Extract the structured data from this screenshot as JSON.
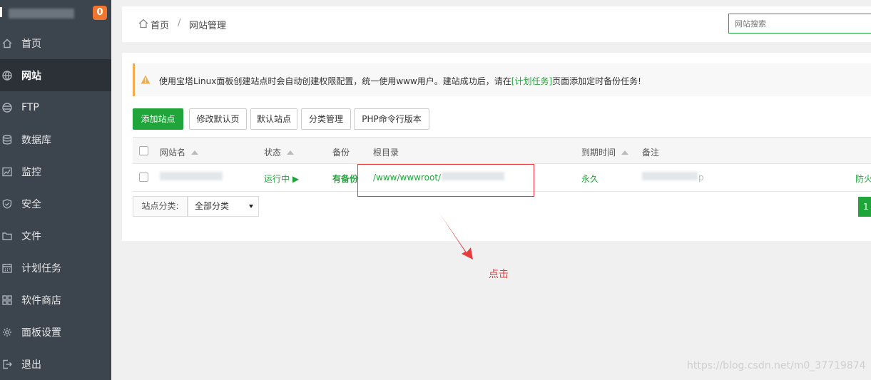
{
  "sidebar": {
    "badge": "0",
    "items": [
      {
        "label": "首页",
        "icon": "home-icon"
      },
      {
        "label": "网站",
        "icon": "globe-icon"
      },
      {
        "label": "FTP",
        "icon": "ftp-icon"
      },
      {
        "label": "数据库",
        "icon": "database-icon"
      },
      {
        "label": "监控",
        "icon": "monitor-icon"
      },
      {
        "label": "安全",
        "icon": "shield-icon"
      },
      {
        "label": "文件",
        "icon": "folder-icon"
      },
      {
        "label": "计划任务",
        "icon": "calendar-icon"
      },
      {
        "label": "软件商店",
        "icon": "grid-icon"
      },
      {
        "label": "面板设置",
        "icon": "gear-icon"
      },
      {
        "label": "退出",
        "icon": "logout-icon"
      }
    ],
    "active_index": 1
  },
  "header": {
    "breadcrumb_home": "首页",
    "breadcrumb_sep": "/",
    "breadcrumb_current": "网站管理",
    "search_placeholder": "网站搜索"
  },
  "notice": {
    "text_before": "使用宝塔Linux面板创建站点时会自动创建权限配置，统一使用www用户。建站成功后，请在",
    "link": "[计划任务]",
    "text_after": "页面添加定时备份任务!"
  },
  "toolbar": {
    "add_site": "添加站点",
    "edit_default_page": "修改默认页",
    "default_site": "默认站点",
    "category_manage": "分类管理",
    "php_cli_version": "PHP命令行版本"
  },
  "table": {
    "headers": {
      "name": "网站名",
      "status": "状态",
      "backup": "备份",
      "root": "根目录",
      "expire": "到期时间",
      "note": "备注"
    },
    "rows": [
      {
        "status": "运行中 ▶",
        "backup": "有备份",
        "root": "/www/wwwroot/",
        "expire": "永久",
        "note_tail": "p",
        "action": "防火"
      }
    ]
  },
  "footer": {
    "category_label": "站点分类:",
    "category_value": "全部分类",
    "page": "1"
  },
  "annotation": {
    "click_text": "点击",
    "watermark": "https://blog.csdn.net/m0_37719874"
  },
  "colors": {
    "accent": "#20a53a",
    "sidebar": "#3c444d",
    "sidebar_active": "#2c3138",
    "badge": "#f0752e",
    "annotation_red": "#e83c3c",
    "notice_border": "#f0ad4e"
  }
}
